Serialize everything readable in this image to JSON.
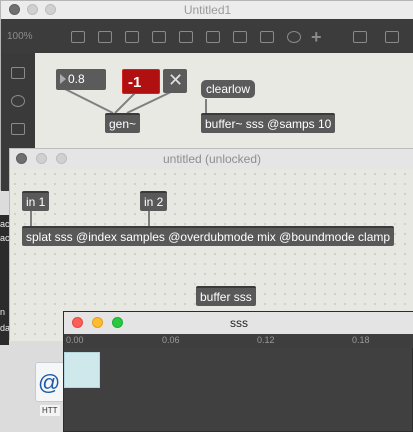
{
  "window_main": {
    "title": "Untitled1",
    "zoom": "100%",
    "objects": {
      "number_value": "0.8",
      "number_red_value": "-1",
      "message_clearlow": "clearlow",
      "gen_box": "gen~",
      "buffer_box": "buffer~ sss @samps 10"
    }
  },
  "window_patch": {
    "title": "untitled (unlocked)",
    "inlet1": "in 1",
    "inlet2": "in 2",
    "splat_box": "splat sss @index samples @overdubmode mix @boundmode clamp",
    "buffer_box": "buffer sss"
  },
  "window_buffer": {
    "title": "sss",
    "ruler_ticks": [
      "0.00",
      "0.06",
      "0.12",
      "0.18"
    ]
  },
  "desktop": {
    "file_label": "HTT",
    "side_fragments": [
      "ac",
      "ac",
      "n",
      "da"
    ]
  },
  "colors": {
    "red_number": "#b01010",
    "dark_toolbar": "#3c3c3c",
    "buffer_cell": "#cfe8ec"
  }
}
